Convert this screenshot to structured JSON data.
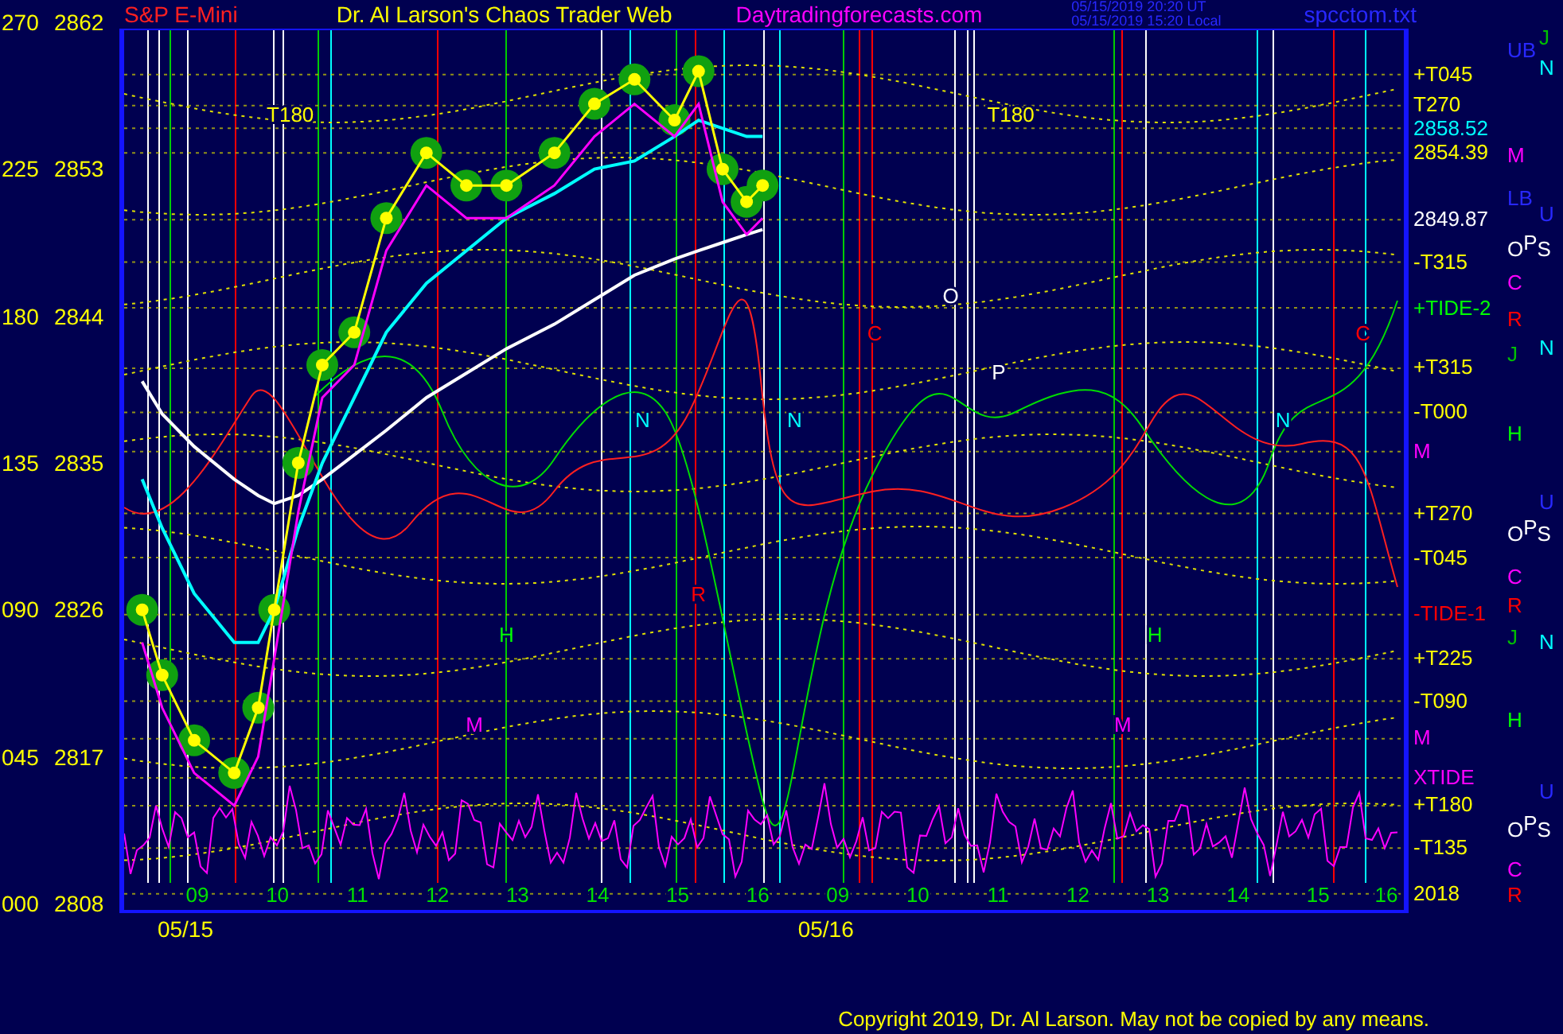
{
  "header": {
    "symbol": "S&P E-Mini",
    "title": "Dr. Al Larson's Chaos Trader Web",
    "site": "Daytradingforecasts.com",
    "time_ut": "05/15/2019 20:20 UT",
    "time_local": "05/15/2019 15:20 Local",
    "file": "spcctom.txt"
  },
  "angle_labels": [
    "270",
    "225",
    "180",
    "135",
    "090",
    "045",
    "000"
  ],
  "chart_data": {
    "type": "line",
    "grid": true,
    "x": [
      8.35,
      8.6,
      9,
      9.5,
      9.8,
      10,
      10.3,
      10.6,
      11,
      11.4,
      11.9,
      12.4,
      12.9,
      13.5,
      14,
      14.5,
      15,
      15.3,
      15.6,
      15.9,
      16.1
    ],
    "xlim": [
      8.125,
      24.11
    ],
    "ylim": [
      2808,
      2862
    ],
    "xticks": [
      {
        "value": 9,
        "label": "09"
      },
      {
        "value": 10,
        "label": "10"
      },
      {
        "value": 11,
        "label": "11"
      },
      {
        "value": 12,
        "label": "12"
      },
      {
        "value": 13,
        "label": "13"
      },
      {
        "value": 14,
        "label": "14"
      },
      {
        "value": 15,
        "label": "15"
      },
      {
        "value": 16,
        "label": "16"
      }
    ],
    "yticks": [
      {
        "value": 2862,
        "label": "2862"
      },
      {
        "value": 2853,
        "label": "2853"
      },
      {
        "value": 2844,
        "label": "2844"
      },
      {
        "value": 2835,
        "label": "2835"
      },
      {
        "value": 2826,
        "label": "2826"
      },
      {
        "value": 2817,
        "label": "2817"
      },
      {
        "value": 2808,
        "label": "2808"
      }
    ],
    "series": [
      {
        "color": "#ffffff",
        "values": [
          2840,
          2838,
          2836,
          2834,
          2833,
          2832.5,
          2833,
          2834,
          2835.5,
          2837,
          2839,
          2840.5,
          2842,
          2843.5,
          2845,
          2846.5,
          2847.5,
          2848,
          2848.5,
          2849,
          2849.3
        ]
      },
      {
        "color": "#00ffff",
        "values": [
          2834,
          2831,
          2827,
          2824,
          2824,
          2826,
          2831,
          2835,
          2839,
          2843,
          2846,
          2848,
          2850,
          2851.5,
          2853,
          2853.5,
          2855,
          2856,
          2855.5,
          2855,
          2855
        ]
      },
      {
        "color": "#ff00ff",
        "values": [
          2824,
          2820,
          2816,
          2814,
          2817,
          2823,
          2832,
          2839,
          2841,
          2848,
          2852,
          2850,
          2850,
          2852,
          2855,
          2857,
          2855,
          2857,
          2851,
          2849,
          2850
        ]
      },
      {
        "color": "#ffff00",
        "marker": "circle",
        "values": [
          2826,
          2822,
          2818,
          2816,
          2820,
          2826,
          2835,
          2841,
          2843,
          2850,
          2854,
          2852,
          2852,
          2854,
          2857,
          2858.5,
          2856,
          2859,
          2853,
          2851,
          2852
        ]
      }
    ]
  },
  "next_day_hours": [
    "09",
    "10",
    "11",
    "12",
    "13",
    "14",
    "15",
    "16"
  ],
  "date_labels": [
    "05/15",
    "05/16"
  ],
  "plot_markers": [
    {
      "text": "T180",
      "color": "#ffff00"
    },
    {
      "text": "T180",
      "color": "#ffff00"
    },
    {
      "text": "N",
      "color": "#00ffff"
    },
    {
      "text": "N",
      "color": "#00ffff"
    },
    {
      "text": "O",
      "color": "#ffffff"
    },
    {
      "text": "P",
      "color": "#ffffff"
    },
    {
      "text": "N",
      "color": "#00ffff"
    },
    {
      "text": "H",
      "color": "#00ff00"
    },
    {
      "text": "H",
      "color": "#00ff00"
    },
    {
      "text": "M",
      "color": "#ff00ff"
    },
    {
      "text": "M",
      "color": "#ff00ff"
    },
    {
      "text": "R",
      "color": "#ff0000"
    },
    {
      "text": "C",
      "color": "#ff0000"
    },
    {
      "text": "C",
      "color": "#ff0000"
    }
  ],
  "right_labels": [
    {
      "text": "+T045",
      "color": "#ffff00"
    },
    {
      "text": "T270",
      "color": "#ffff00"
    },
    {
      "text": "2858.52",
      "color": "#00ffff"
    },
    {
      "text": "2854.39",
      "color": "#ffff00"
    },
    {
      "text": "2849.87",
      "color": "#ffffff"
    },
    {
      "text": "-T315",
      "color": "#ffff00"
    },
    {
      "text": "+TIDE-2",
      "color": "#00ff00"
    },
    {
      "text": "+T315",
      "color": "#ffff00"
    },
    {
      "text": "-T000",
      "color": "#ffff00"
    },
    {
      "text": "M",
      "color": "#ff00ff"
    },
    {
      "text": "+T270",
      "color": "#ffff00"
    },
    {
      "text": "-T045",
      "color": "#ffff00"
    },
    {
      "text": "-TIDE-1",
      "color": "#ff0000"
    },
    {
      "text": "+T225",
      "color": "#ffff00"
    },
    {
      "text": "-T090",
      "color": "#ffff00"
    },
    {
      "text": "M",
      "color": "#ff00ff"
    },
    {
      "text": "XTIDE",
      "color": "#ff00ff"
    },
    {
      "text": "+T180",
      "color": "#ffff00"
    },
    {
      "text": "-T135",
      "color": "#ffff00"
    },
    {
      "text": "2018",
      "color": "#ffff00"
    },
    {
      "text": "UB",
      "color": "#2828ff"
    },
    {
      "text": "M",
      "color": "#ff00ff"
    },
    {
      "text": "LB",
      "color": "#2828ff"
    },
    {
      "text": "O$^{P}$S",
      "color": "#ffffff"
    },
    {
      "text": "C",
      "color": "#ff00ff"
    },
    {
      "text": "R",
      "color": "#ff0000"
    },
    {
      "text": "J",
      "color": "#00c000"
    },
    {
      "text": "H",
      "color": "#00ff00"
    },
    {
      "text": "O$^{P}$S",
      "color": "#ffffff"
    },
    {
      "text": "C",
      "color": "#ff00ff"
    },
    {
      "text": "R",
      "color": "#ff0000"
    },
    {
      "text": "J",
      "color": "#00c000"
    },
    {
      "text": "H",
      "color": "#00ff00"
    },
    {
      "text": "O$^{P}$S",
      "color": "#ffffff"
    },
    {
      "text": "C",
      "color": "#ff00ff"
    },
    {
      "text": "R",
      "color": "#ff0000"
    },
    {
      "text": "J",
      "color": "#00c000"
    },
    {
      "text": "N",
      "color": "#00ffff"
    },
    {
      "text": "U",
      "color": "#2828ff"
    },
    {
      "text": "N",
      "color": "#00ffff"
    },
    {
      "text": "U",
      "color": "#2828ff"
    },
    {
      "text": "N",
      "color": "#00ffff"
    },
    {
      "text": "U",
      "color": "#2828ff"
    }
  ],
  "copyright": "Copyright 2019, Dr. Al Larson. May not be copied by any means."
}
